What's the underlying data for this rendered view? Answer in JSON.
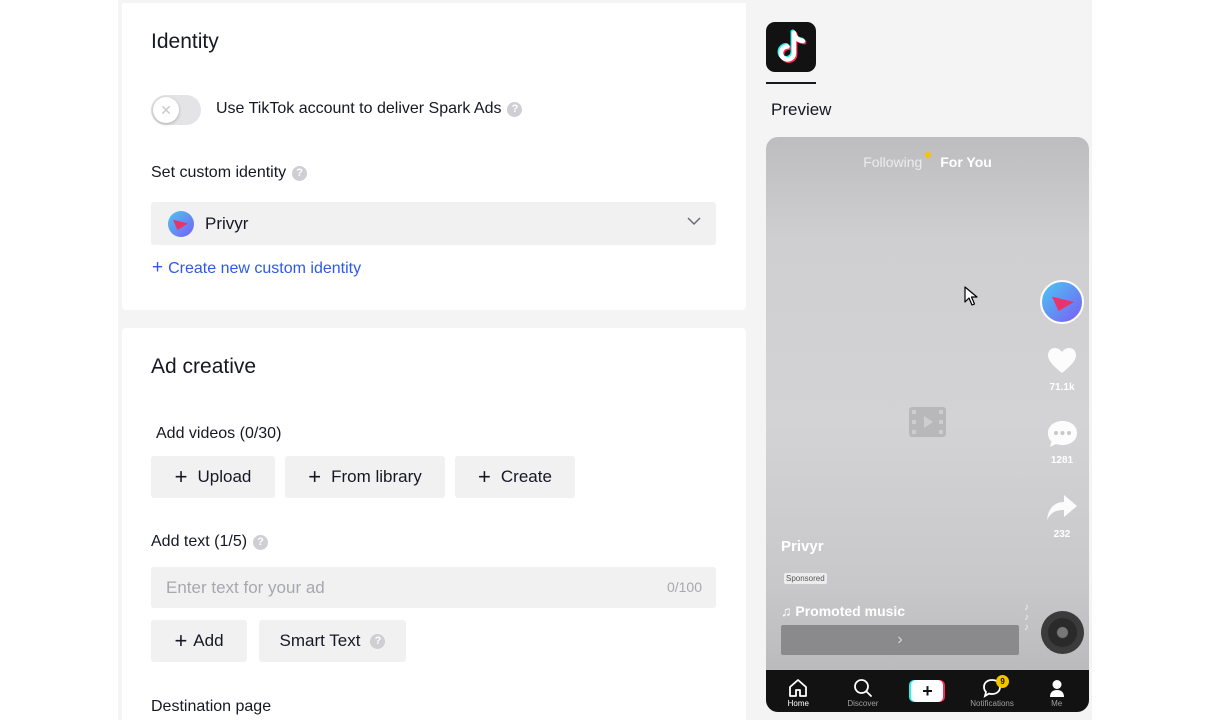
{
  "identity": {
    "title": "Identity",
    "spark_toggle_label": "Use TikTok account to deliver Spark Ads",
    "spark_toggle_on": false,
    "custom_identity_label": "Set custom identity",
    "selected_identity": "Privyr",
    "create_identity_link": "Create new custom identity"
  },
  "ad_creative": {
    "title": "Ad creative",
    "add_videos_label": "Add videos (0/30)",
    "video_buttons": {
      "upload": "Upload",
      "from_library": "From library",
      "create": "Create"
    },
    "add_text_label": "Add text (1/5)",
    "text_placeholder": "Enter text for your ad",
    "text_counter": "0/100",
    "add_button": "Add",
    "smart_text_button": "Smart Text",
    "destination_label": "Destination page"
  },
  "preview": {
    "label": "Preview",
    "tabs": {
      "following": "Following",
      "for_you": "For You"
    },
    "username": "Privyr",
    "sponsored": "Sponsored",
    "music": "Promoted music",
    "likes": "71.1k",
    "comments": "1281",
    "shares": "232",
    "nav": {
      "home": "Home",
      "discover": "Discover",
      "notifications": "Notifications",
      "notifications_badge": "9",
      "me": "Me"
    }
  },
  "colors": {
    "link": "#2c5ae9",
    "badge": "#f5c400",
    "tiktok_cyan": "#25f4ee",
    "tiktok_red": "#fe2c55"
  }
}
